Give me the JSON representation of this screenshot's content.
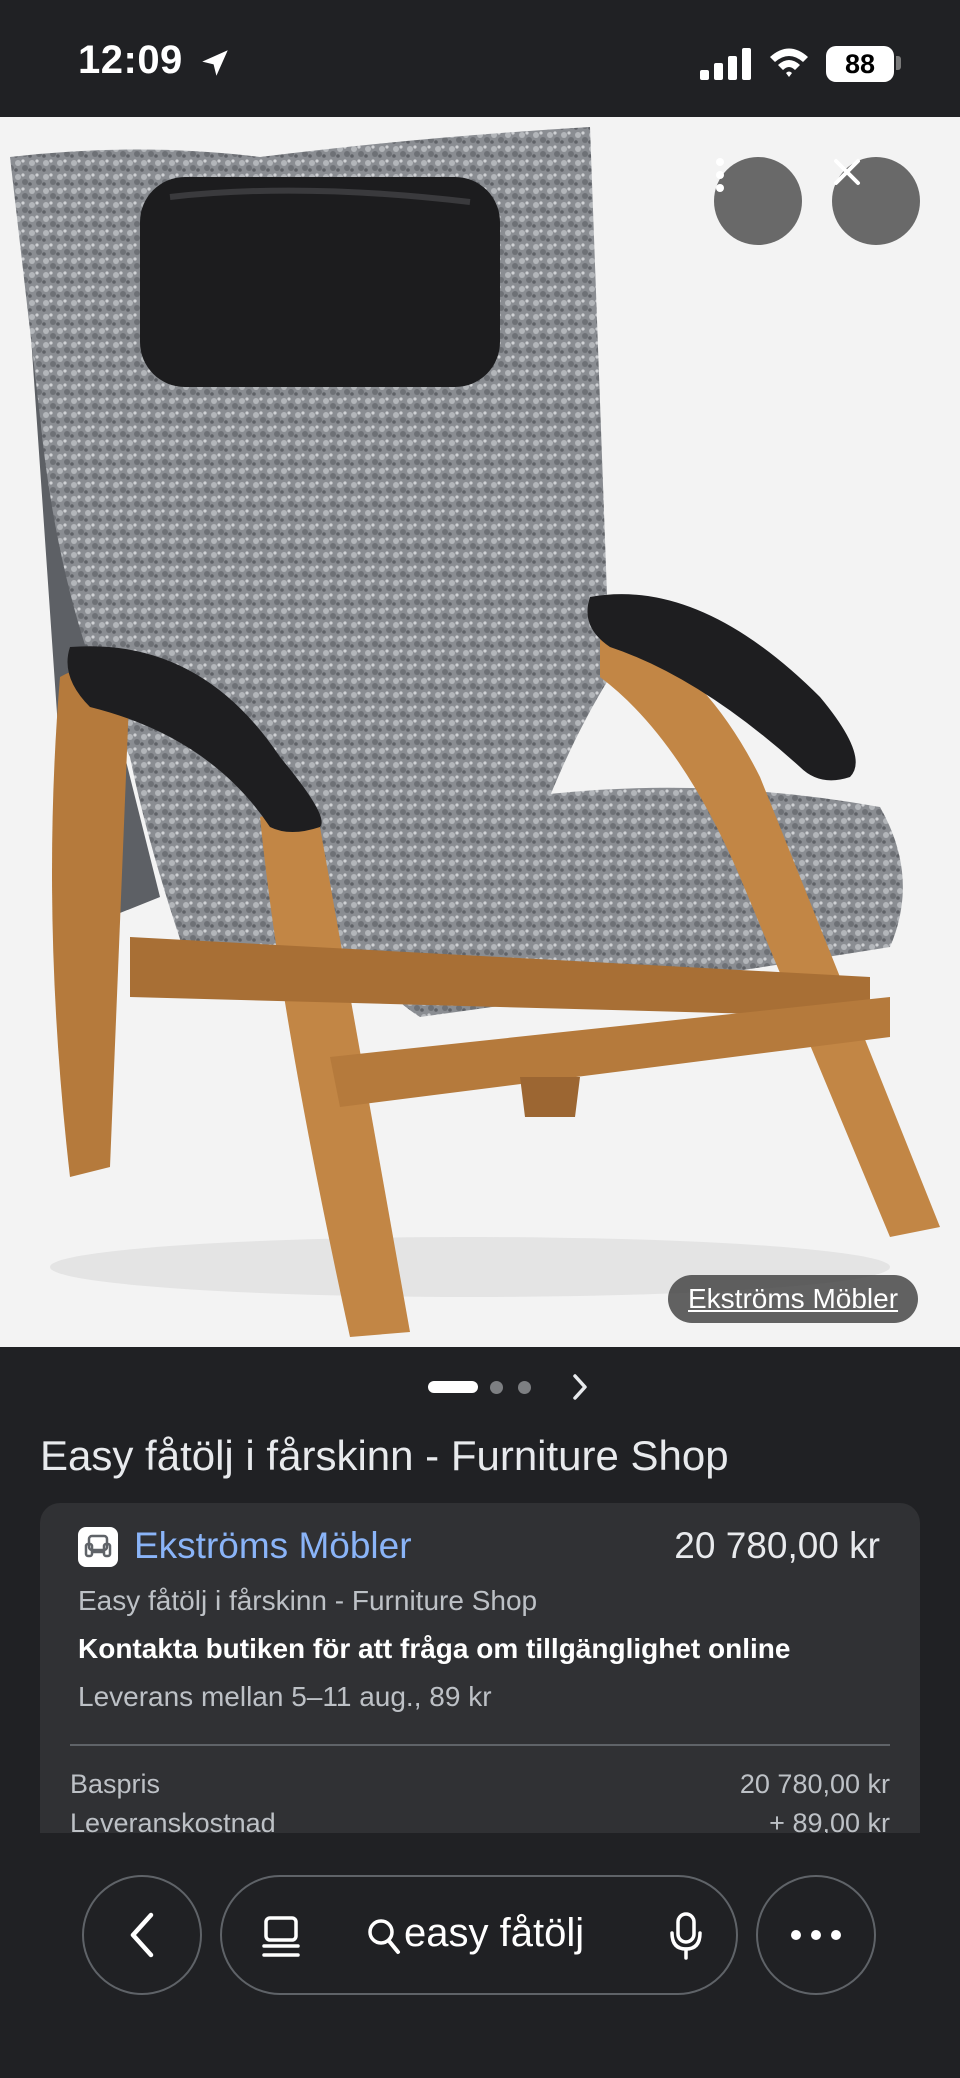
{
  "status_bar": {
    "time": "12:09",
    "battery": "88",
    "icons": [
      "location-arrow-icon",
      "cellular-signal-icon",
      "wifi-icon",
      "battery-icon"
    ]
  },
  "image_viewer": {
    "source_chip": "Ekströms Möbler",
    "buttons": [
      "more-options-icon",
      "close-icon"
    ],
    "carousel": {
      "total": 3,
      "active": 1
    }
  },
  "result": {
    "title": "Easy fåtölj i fårskinn - Furniture Shop"
  },
  "product_card": {
    "store_name": "Ekströms Möbler",
    "store_icon": "store-armchair-icon",
    "price": "20 780,00 kr",
    "subtitle": "Easy fåtölj i fårskinn - Furniture Shop",
    "availability": "Kontakta butiken för att fråga om tillgänglighet online",
    "delivery": "Leverans mellan 5–11 aug., 89 kr",
    "rows": [
      {
        "label": "Baspris",
        "value": "20 780,00 kr"
      },
      {
        "label": "Leveranskostnad",
        "value": "+ 89,00 kr"
      }
    ]
  },
  "toolbar": {
    "query": "easy fåtölj",
    "icons": [
      "back-chevron-icon",
      "tabs-icon",
      "search-icon",
      "microphone-icon",
      "more-horizontal-icon"
    ]
  },
  "colors": {
    "background": "#202124",
    "card": "#303134",
    "link": "#8ab4f8",
    "image_bg": "#f3f3f3"
  }
}
